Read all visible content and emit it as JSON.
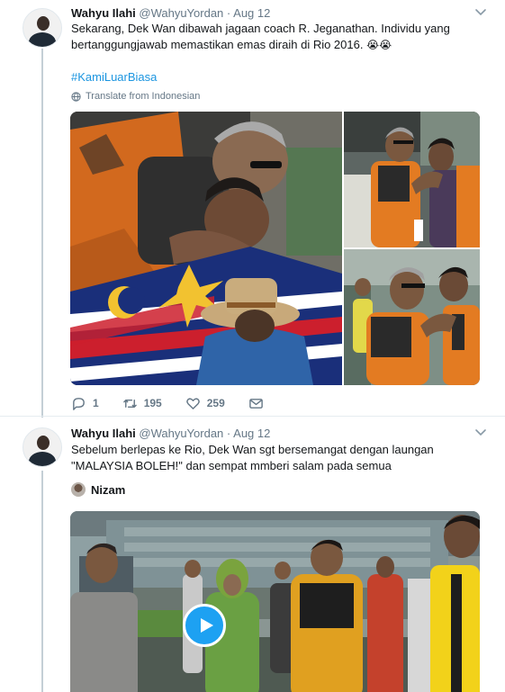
{
  "tweets": [
    {
      "author_name": "Wahyu Ilahi",
      "handle": "@WahyuYordan",
      "separator": "·",
      "date": "Aug 12",
      "text_line1": "Sekarang, Dek Wan dibawah jagaan coach R. Jeganathan. Individu yang",
      "text_line2": "bertanggungjawab memastikan emas diraih di Rio 2016.",
      "emoji": "😭😭",
      "hashtag": "#KamiLuarBiasa",
      "translate": "Translate from Indonesian",
      "replies": "1",
      "retweets": "195",
      "likes": "259"
    },
    {
      "author_name": "Wahyu Ilahi",
      "handle": "@WahyuYordan",
      "separator": "·",
      "date": "Aug 12",
      "text_line1": "Sebelum berlepas ke Rio, Dek Wan sgt bersemangat dengan laungan",
      "text_line2": "\"MALAYSIA BOLEH!\" dan sempat mmberi salam pada semua",
      "quoted_author": "Nizam"
    }
  ],
  "colors": {
    "accent": "#1da1f2",
    "hashtag": "#1b95e0",
    "muted": "#657786",
    "thread_line": "#c4cfd6"
  },
  "icons": [
    "caret-down-icon",
    "globe-icon",
    "reply-icon",
    "retweet-icon",
    "heart-icon",
    "envelope-icon",
    "play-icon"
  ]
}
